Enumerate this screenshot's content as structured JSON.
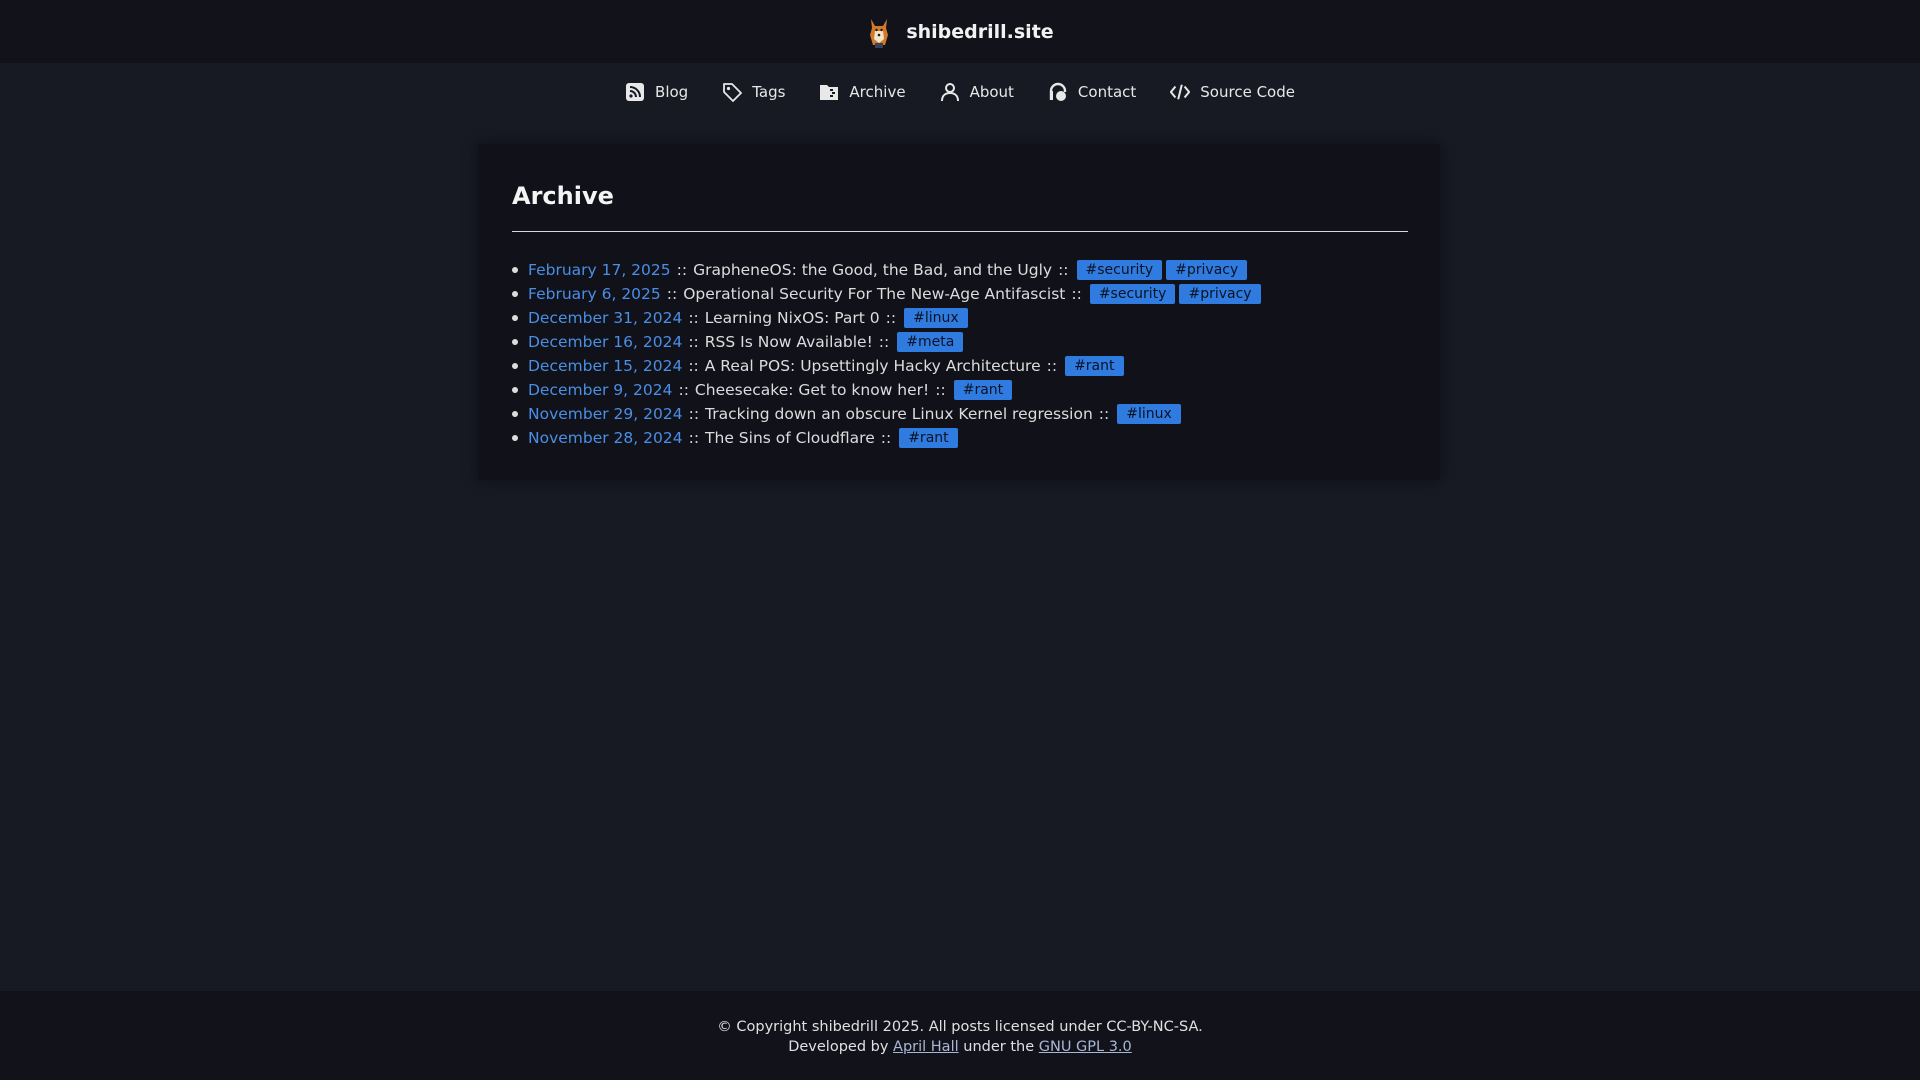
{
  "header": {
    "site_title": "shibedrill.site",
    "logo_icon": "shiba-dog-logo"
  },
  "nav": {
    "items": [
      {
        "label": "Blog",
        "icon": "rss-icon"
      },
      {
        "label": "Tags",
        "icon": "tag-icon"
      },
      {
        "label": "Archive",
        "icon": "archive-icon"
      },
      {
        "label": "About",
        "icon": "user-icon"
      },
      {
        "label": "Contact",
        "icon": "contact-icon"
      },
      {
        "label": "Source Code",
        "icon": "code-icon"
      }
    ]
  },
  "main": {
    "title": "Archive",
    "separator": "::",
    "posts": [
      {
        "date": "February 17, 2025",
        "title": "GrapheneOS: the Good, the Bad, and the Ugly",
        "tags": [
          "#security",
          "#privacy"
        ]
      },
      {
        "date": "February 6, 2025",
        "title": "Operational Security For The New-Age Antifascist",
        "tags": [
          "#security",
          "#privacy"
        ]
      },
      {
        "date": "December 31, 2024",
        "title": "Learning NixOS: Part 0",
        "tags": [
          "#linux"
        ]
      },
      {
        "date": "December 16, 2024",
        "title": "RSS Is Now Available!",
        "tags": [
          "#meta"
        ]
      },
      {
        "date": "December 15, 2024",
        "title": "A Real POS: Upsettingly Hacky Architecture",
        "tags": [
          "#rant"
        ]
      },
      {
        "date": "December 9, 2024",
        "title": "Cheesecake: Get to know her!",
        "tags": [
          "#rant"
        ]
      },
      {
        "date": "November 29, 2024",
        "title": "Tracking down an obscure Linux Kernel regression",
        "tags": [
          "#linux"
        ]
      },
      {
        "date": "November 28, 2024",
        "title": "The Sins of Cloudflare",
        "tags": [
          "#rant"
        ]
      }
    ]
  },
  "footer": {
    "copyright": "© Copyright shibedrill 2025. All posts licensed under CC-BY-NC-SA.",
    "developed_by_prefix": "Developed by",
    "developer_link": "April Hall",
    "license_prefix": "under the",
    "license_link": "GNU GPL 3.0"
  },
  "colors": {
    "background": "#171923",
    "bar": "#12131a",
    "card": "#111219",
    "link": "#4a8ee6",
    "tag": "#2f7be0"
  }
}
